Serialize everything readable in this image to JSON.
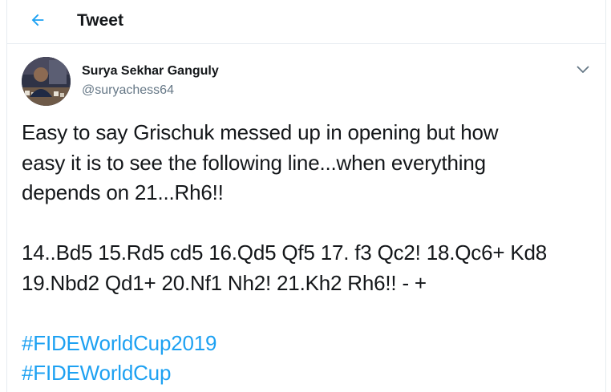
{
  "header": {
    "title": "Tweet",
    "back_icon": "arrow-left-icon",
    "accent_color": "#1da1f2"
  },
  "author": {
    "name": "Surya Sekhar Ganguly",
    "handle": "@suryachess64",
    "avatar": "avatar-photo",
    "menu_icon": "chevron-down-icon"
  },
  "tweet": {
    "lines": [
      "Easy to say Grischuk messed up in opening but how",
      "easy it is to see the following line...when everything",
      "depends on 21...Rh6!!"
    ],
    "moves": [
      "14..Bd5 15.Rd5 cd5 16.Qd5 Qf5 17. f3 Qc2! 18.Qc6+ Kd8",
      "19.Nbd2 Qd1+ 20.Nf1 Nh2! 21.Kh2 Rh6!! - +"
    ],
    "hashtags": [
      "#FIDEWorldCup2019",
      "#FIDEWorldCup"
    ]
  },
  "colors": {
    "text": "#14171a",
    "secondary": "#657786",
    "link": "#1da1f2",
    "border": "#e6ecf0"
  }
}
